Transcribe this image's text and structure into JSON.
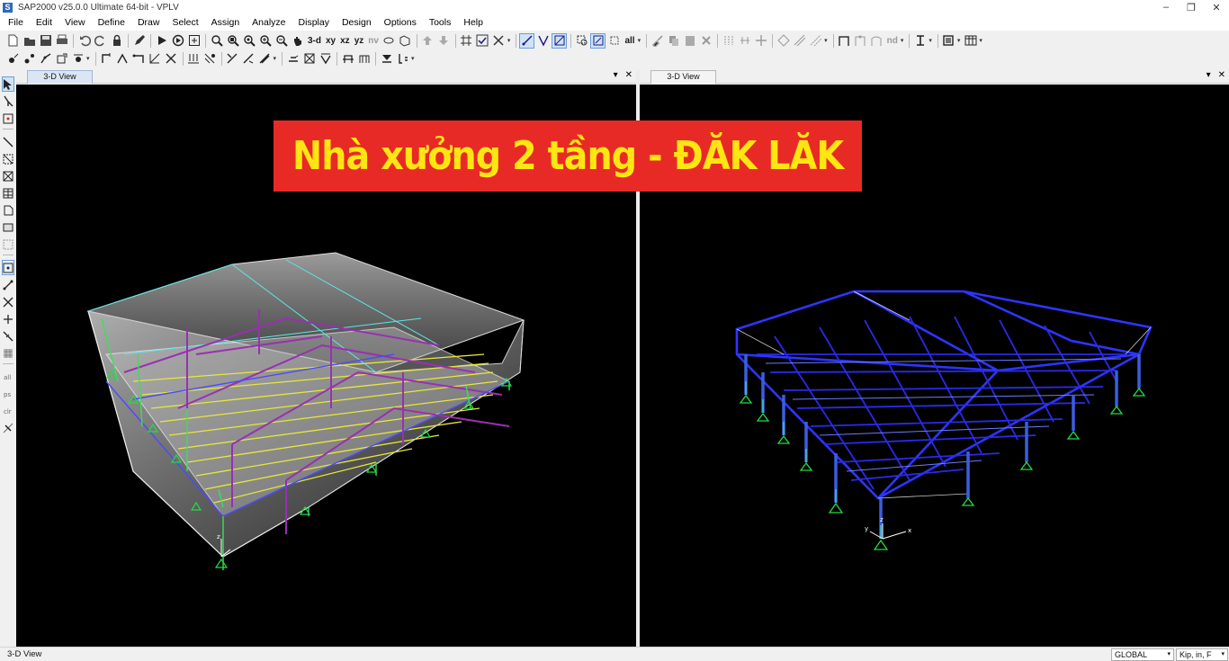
{
  "window": {
    "title": "SAP2000 v25.0.0 Ultimate 64-bit - VPLV",
    "logo_letter": "S"
  },
  "menu": [
    "File",
    "Edit",
    "View",
    "Define",
    "Draw",
    "Select",
    "Assign",
    "Analyze",
    "Display",
    "Design",
    "Options",
    "Tools",
    "Help"
  ],
  "toolbar": {
    "view_buttons": [
      "3-d",
      "xy",
      "xz",
      "yz",
      "nv"
    ],
    "select_all": "all",
    "nd": "nd"
  },
  "views": [
    {
      "tab": "3-D View"
    },
    {
      "tab": "3-D View"
    }
  ],
  "banner": {
    "text": "Nhà xưởng 2 tầng - ĐĂK LĂK",
    "bg_color": "#e82a26",
    "text_color": "#ffe612"
  },
  "status": {
    "text": "3-D View",
    "coord_system": "GLOBAL",
    "units": "Kip, in, F"
  },
  "colors": {
    "viewport_bg": "#000000",
    "frame_blue": "#2a2aff",
    "frame_purple": "#8a2aa0",
    "support_green": "#21d24a"
  }
}
